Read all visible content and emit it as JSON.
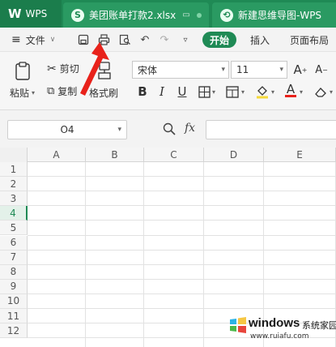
{
  "tabs": {
    "app": "WPS",
    "file_tab": "美团账单打款2.xlsx",
    "mind_tab": "新建思维导图-WPS"
  },
  "menu": {
    "file": "文件",
    "start": "开始",
    "insert": "插入",
    "layout": "页面布局"
  },
  "ribbon": {
    "paste": "粘贴",
    "cut": "剪切",
    "copy": "复制",
    "format_painter": "格式刷",
    "font_name": "宋体",
    "font_size": "11",
    "bold": "B",
    "italic": "I",
    "underline": "U",
    "font_color_letter": "A"
  },
  "formula_bar": {
    "name_box": "O4",
    "fx": "fx"
  },
  "grid": {
    "columns": [
      "A",
      "B",
      "C",
      "D",
      "E"
    ],
    "rows": [
      "1",
      "2",
      "3",
      "4",
      "5",
      "6",
      "7",
      "8",
      "9",
      "10",
      "11",
      "12"
    ],
    "active_row": "4"
  },
  "colors": {
    "brand_green": "#1f8a55",
    "annotation_red": "#e8221b"
  },
  "watermark": {
    "brand": "windows",
    "suffix": "系统家园",
    "url": "www.ruiafu.com"
  }
}
